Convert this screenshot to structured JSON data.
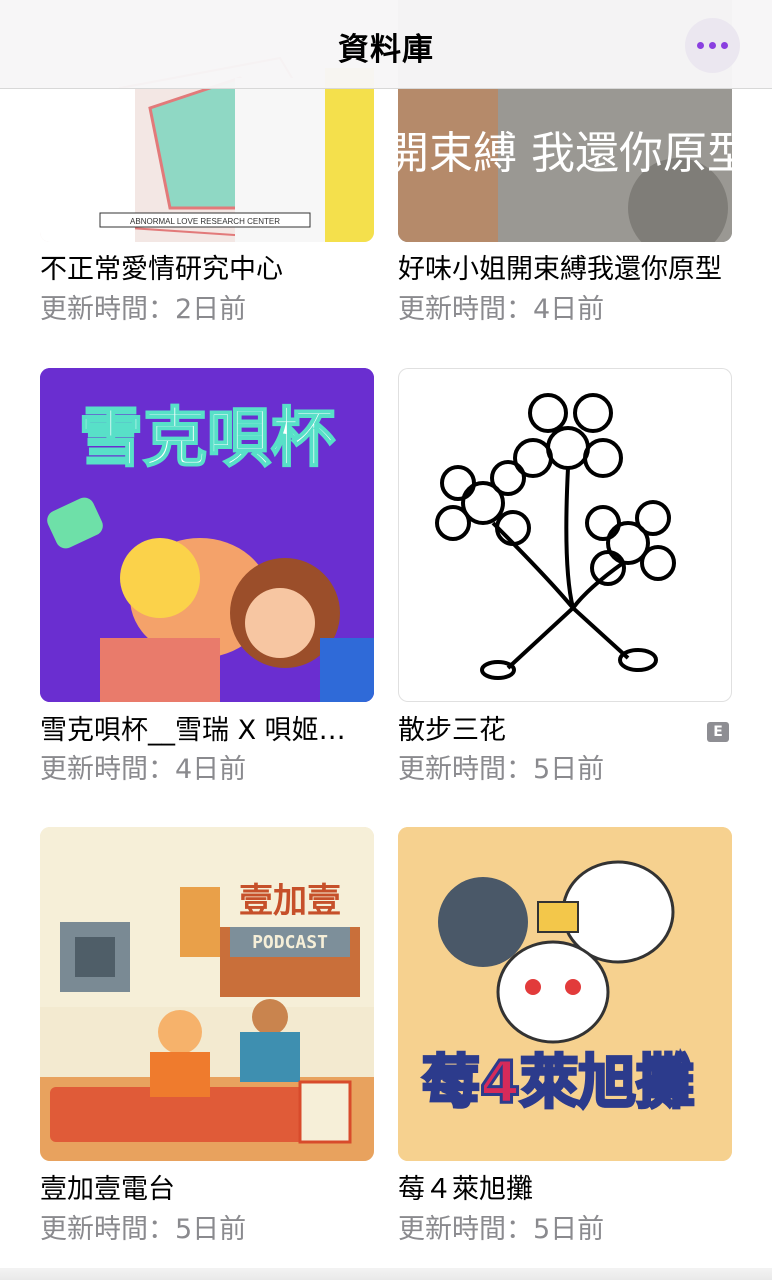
{
  "navbar": {
    "title": "資料庫",
    "more_icon": "more-icon"
  },
  "podcasts": [
    {
      "title": "不正常愛情研究中心",
      "updated": "更新時間：2日前",
      "art_text": "ABNORMAL LOVE RESEARCH CENTER"
    },
    {
      "title": "好味小姐開束縛我還你原型",
      "updated": "更新時間：4日前",
      "art_text": "開束縛 我還你原型"
    },
    {
      "title": "雪克唄杯__雪瑞 X 唄姬…",
      "updated": "更新時間：4日前",
      "art_text": "雪克唄杯"
    },
    {
      "title": "散步三花",
      "updated": "更新時間：5日前",
      "explicit": "E"
    },
    {
      "title": "壹加壹電台",
      "updated": "更新時間：5日前",
      "art_text": "壹加壹",
      "art_sub": "PODCAST"
    },
    {
      "title": "莓４萊旭攤",
      "updated": "更新時間：5日前",
      "art_text": "莓4萊旭攤"
    }
  ],
  "colors": {
    "accent": "#8a3fe0",
    "secondary_text": "#8a8a8e",
    "snowcup_bg": "#6a2ed0",
    "berry_bg": "#f6d18f"
  }
}
